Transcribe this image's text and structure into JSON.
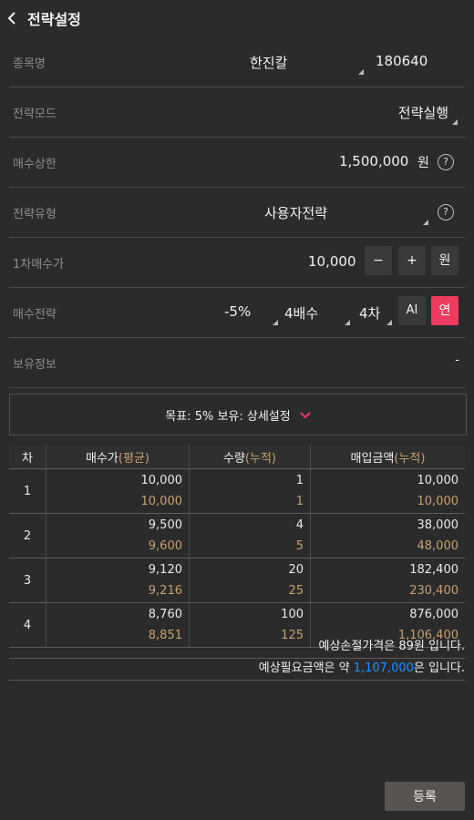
{
  "header": {
    "title": "전략설정"
  },
  "rows": {
    "stock": {
      "label": "종목명",
      "name": "한진칼",
      "code": "180640"
    },
    "mode": {
      "label": "전략모드",
      "value": "전략실행"
    },
    "limit": {
      "label": "매수상한",
      "value": "1,500,000",
      "unit": "원",
      "help": "?"
    },
    "type": {
      "label": "전략유형",
      "value": "사용자전략",
      "help": "?"
    },
    "first_price": {
      "label": "1차매수가",
      "value": "10,000",
      "minus": "−",
      "plus": "+",
      "unit": "원"
    },
    "buy_strategy": {
      "label": "매수전략",
      "pct": "-5%",
      "mult": "4배수",
      "steps": "4차",
      "ai": "AI",
      "yeon": "연"
    },
    "holding": {
      "label": "보유정보",
      "value": "-"
    }
  },
  "summary_panel": {
    "text": "목표: 5% 보유: 상세설정"
  },
  "table": {
    "headers": {
      "col1": "차",
      "col2_main": "매수가",
      "col2_sub": "(평균)",
      "col3_main": "수량",
      "col3_sub": "(누적)",
      "col4_main": "매입금액",
      "col4_sub": "(누적)"
    },
    "rows": [
      {
        "no": "1",
        "price": "10,000",
        "avg": "10,000",
        "qty": "1",
        "cum_qty": "1",
        "amount": "10,000",
        "cum_amount": "10,000"
      },
      {
        "no": "2",
        "price": "9,500",
        "avg": "9,600",
        "qty": "4",
        "cum_qty": "5",
        "amount": "38,000",
        "cum_amount": "48,000"
      },
      {
        "no": "3",
        "price": "9,120",
        "avg": "9,216",
        "qty": "20",
        "cum_qty": "25",
        "amount": "182,400",
        "cum_amount": "230,400"
      },
      {
        "no": "4",
        "price": "8,760",
        "avg": "8,851",
        "qty": "100",
        "cum_qty": "125",
        "amount": "876,000",
        "cum_amount": "1,106,400"
      }
    ]
  },
  "notes": {
    "stoploss": "예상손절가격은 89원 입니다.",
    "required_prefix": "예상필요금액은 약 ",
    "required_amount": "1,107,000",
    "required_suffix": "은 입니다."
  },
  "footer": {
    "register_label": "등록"
  },
  "colors": {
    "accent_pink": "#ef3b5f",
    "gold": "#c7a06d",
    "blue": "#1f8fff"
  }
}
